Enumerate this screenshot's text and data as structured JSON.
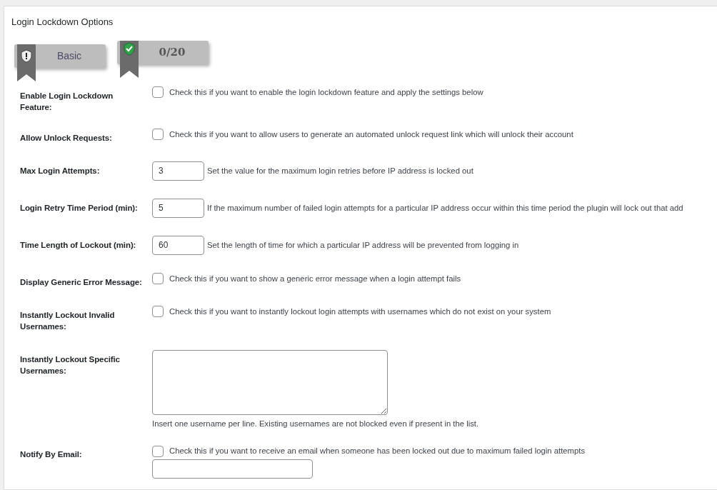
{
  "section": {
    "title": "Login Lockdown Options"
  },
  "badges": [
    {
      "kind": "rank",
      "text": "Basic"
    },
    {
      "kind": "points",
      "text": "0/20"
    }
  ],
  "settings": [
    {
      "kind": "checkbox",
      "label": "Enable Login Lockdown Feature:",
      "checked": false,
      "description": "Check this if you want to enable the login lockdown feature and apply the settings below"
    },
    {
      "kind": "checkbox",
      "label": "Allow Unlock Requests:",
      "checked": false,
      "description": "Check this if you want to allow users to generate an automated unlock request link which will unlock their account"
    },
    {
      "kind": "number",
      "label": "Max Login Attempts:",
      "value": "3",
      "description": "Set the value for the maximum login retries before IP address is locked out"
    },
    {
      "kind": "number",
      "label": "Login Retry Time Period (min):",
      "value": "5",
      "description": "If the maximum number of failed login attempts for a particular IP address occur within this time period the plugin will lock out that add"
    },
    {
      "kind": "number",
      "label": "Time Length of Lockout (min):",
      "value": "60",
      "description": "Set the length of time for which a particular IP address will be prevented from logging in"
    },
    {
      "kind": "checkbox",
      "label": "Display Generic Error Message:",
      "checked": false,
      "description": "Check this if you want to show a generic error message when a login attempt fails"
    },
    {
      "kind": "checkbox",
      "label": "Instantly Lockout Invalid Usernames:",
      "checked": false,
      "description": "Check this if you want to instantly lockout login attempts with usernames which do not exist on your system"
    },
    {
      "kind": "textarea",
      "label": "Instantly Lockout Specific Usernames:",
      "help": "Insert one username per line. Existing usernames are not blocked even if present in the list."
    },
    {
      "kind": "checkbox",
      "label": "Notify By Email:",
      "checked": false,
      "description": "Check this if you want to receive an email when someone has been locked out due to maximum failed login attempts",
      "email_field": true
    }
  ]
}
